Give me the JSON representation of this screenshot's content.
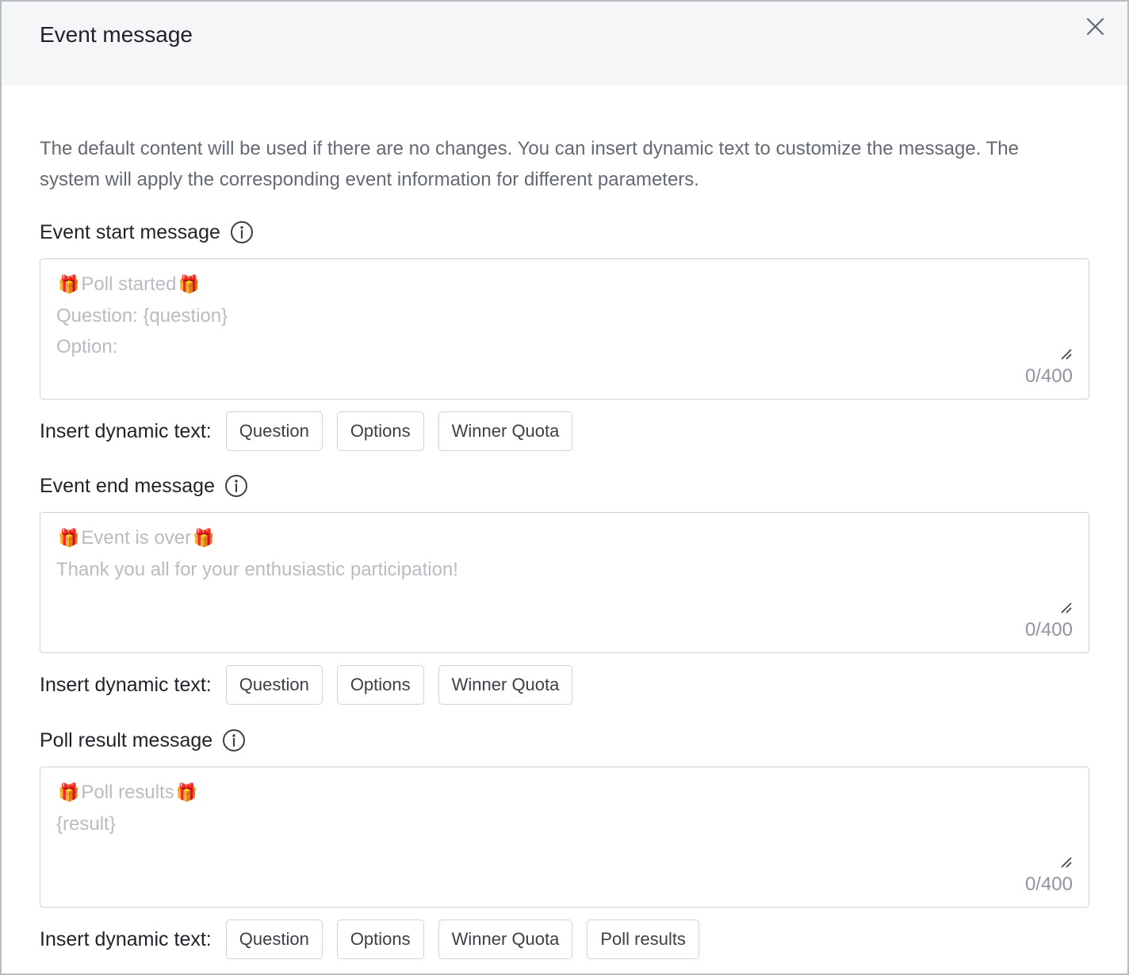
{
  "dialog": {
    "title": "Event message",
    "close_icon": "close-icon"
  },
  "description": "The default content will be used if there are no changes. You can insert dynamic text to customize the message. The system will apply the corresponding event information for different parameters.",
  "sections": [
    {
      "title": "Event start message",
      "info_icon": "info-icon",
      "placeholder_lines": [
        "Poll started",
        "Question: {question}",
        "Option:"
      ],
      "first_line_has_gifts": true,
      "counter": "0/400",
      "insert_label": "Insert dynamic text:",
      "chips": [
        "Question",
        "Options",
        "Winner Quota"
      ]
    },
    {
      "title": "Event end message",
      "info_icon": "info-icon",
      "placeholder_lines": [
        "Event is over",
        "Thank you all for your enthusiastic participation!"
      ],
      "first_line_has_gifts": true,
      "counter": "0/400",
      "insert_label": "Insert dynamic text:",
      "chips": [
        "Question",
        "Options",
        "Winner Quota"
      ]
    },
    {
      "title": "Poll result message",
      "info_icon": "info-icon",
      "placeholder_lines": [
        "Poll results",
        "{result}"
      ],
      "first_line_has_gifts": true,
      "counter": "0/400",
      "insert_label": "Insert dynamic text:",
      "chips": [
        "Question",
        "Options",
        "Winner Quota",
        "Poll results"
      ]
    }
  ],
  "icons": {
    "gift": "🎁",
    "gift_icon_name": "gift-icon",
    "resize_icon_name": "resize-handle-icon"
  }
}
